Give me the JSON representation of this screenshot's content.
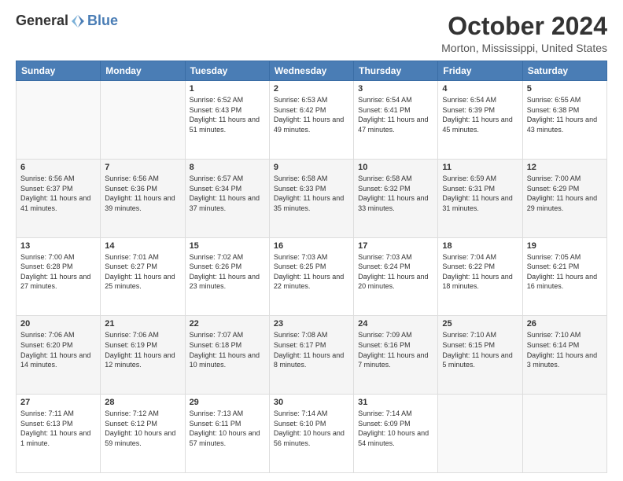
{
  "header": {
    "logo_general": "General",
    "logo_blue": "Blue",
    "month_title": "October 2024",
    "location": "Morton, Mississippi, United States"
  },
  "days_of_week": [
    "Sunday",
    "Monday",
    "Tuesday",
    "Wednesday",
    "Thursday",
    "Friday",
    "Saturday"
  ],
  "weeks": [
    [
      {
        "day": "",
        "info": ""
      },
      {
        "day": "",
        "info": ""
      },
      {
        "day": "1",
        "info": "Sunrise: 6:52 AM\nSunset: 6:43 PM\nDaylight: 11 hours and 51 minutes."
      },
      {
        "day": "2",
        "info": "Sunrise: 6:53 AM\nSunset: 6:42 PM\nDaylight: 11 hours and 49 minutes."
      },
      {
        "day": "3",
        "info": "Sunrise: 6:54 AM\nSunset: 6:41 PM\nDaylight: 11 hours and 47 minutes."
      },
      {
        "day": "4",
        "info": "Sunrise: 6:54 AM\nSunset: 6:39 PM\nDaylight: 11 hours and 45 minutes."
      },
      {
        "day": "5",
        "info": "Sunrise: 6:55 AM\nSunset: 6:38 PM\nDaylight: 11 hours and 43 minutes."
      }
    ],
    [
      {
        "day": "6",
        "info": "Sunrise: 6:56 AM\nSunset: 6:37 PM\nDaylight: 11 hours and 41 minutes."
      },
      {
        "day": "7",
        "info": "Sunrise: 6:56 AM\nSunset: 6:36 PM\nDaylight: 11 hours and 39 minutes."
      },
      {
        "day": "8",
        "info": "Sunrise: 6:57 AM\nSunset: 6:34 PM\nDaylight: 11 hours and 37 minutes."
      },
      {
        "day": "9",
        "info": "Sunrise: 6:58 AM\nSunset: 6:33 PM\nDaylight: 11 hours and 35 minutes."
      },
      {
        "day": "10",
        "info": "Sunrise: 6:58 AM\nSunset: 6:32 PM\nDaylight: 11 hours and 33 minutes."
      },
      {
        "day": "11",
        "info": "Sunrise: 6:59 AM\nSunset: 6:31 PM\nDaylight: 11 hours and 31 minutes."
      },
      {
        "day": "12",
        "info": "Sunrise: 7:00 AM\nSunset: 6:29 PM\nDaylight: 11 hours and 29 minutes."
      }
    ],
    [
      {
        "day": "13",
        "info": "Sunrise: 7:00 AM\nSunset: 6:28 PM\nDaylight: 11 hours and 27 minutes."
      },
      {
        "day": "14",
        "info": "Sunrise: 7:01 AM\nSunset: 6:27 PM\nDaylight: 11 hours and 25 minutes."
      },
      {
        "day": "15",
        "info": "Sunrise: 7:02 AM\nSunset: 6:26 PM\nDaylight: 11 hours and 23 minutes."
      },
      {
        "day": "16",
        "info": "Sunrise: 7:03 AM\nSunset: 6:25 PM\nDaylight: 11 hours and 22 minutes."
      },
      {
        "day": "17",
        "info": "Sunrise: 7:03 AM\nSunset: 6:24 PM\nDaylight: 11 hours and 20 minutes."
      },
      {
        "day": "18",
        "info": "Sunrise: 7:04 AM\nSunset: 6:22 PM\nDaylight: 11 hours and 18 minutes."
      },
      {
        "day": "19",
        "info": "Sunrise: 7:05 AM\nSunset: 6:21 PM\nDaylight: 11 hours and 16 minutes."
      }
    ],
    [
      {
        "day": "20",
        "info": "Sunrise: 7:06 AM\nSunset: 6:20 PM\nDaylight: 11 hours and 14 minutes."
      },
      {
        "day": "21",
        "info": "Sunrise: 7:06 AM\nSunset: 6:19 PM\nDaylight: 11 hours and 12 minutes."
      },
      {
        "day": "22",
        "info": "Sunrise: 7:07 AM\nSunset: 6:18 PM\nDaylight: 11 hours and 10 minutes."
      },
      {
        "day": "23",
        "info": "Sunrise: 7:08 AM\nSunset: 6:17 PM\nDaylight: 11 hours and 8 minutes."
      },
      {
        "day": "24",
        "info": "Sunrise: 7:09 AM\nSunset: 6:16 PM\nDaylight: 11 hours and 7 minutes."
      },
      {
        "day": "25",
        "info": "Sunrise: 7:10 AM\nSunset: 6:15 PM\nDaylight: 11 hours and 5 minutes."
      },
      {
        "day": "26",
        "info": "Sunrise: 7:10 AM\nSunset: 6:14 PM\nDaylight: 11 hours and 3 minutes."
      }
    ],
    [
      {
        "day": "27",
        "info": "Sunrise: 7:11 AM\nSunset: 6:13 PM\nDaylight: 11 hours and 1 minute."
      },
      {
        "day": "28",
        "info": "Sunrise: 7:12 AM\nSunset: 6:12 PM\nDaylight: 10 hours and 59 minutes."
      },
      {
        "day": "29",
        "info": "Sunrise: 7:13 AM\nSunset: 6:11 PM\nDaylight: 10 hours and 57 minutes."
      },
      {
        "day": "30",
        "info": "Sunrise: 7:14 AM\nSunset: 6:10 PM\nDaylight: 10 hours and 56 minutes."
      },
      {
        "day": "31",
        "info": "Sunrise: 7:14 AM\nSunset: 6:09 PM\nDaylight: 10 hours and 54 minutes."
      },
      {
        "day": "",
        "info": ""
      },
      {
        "day": "",
        "info": ""
      }
    ]
  ]
}
